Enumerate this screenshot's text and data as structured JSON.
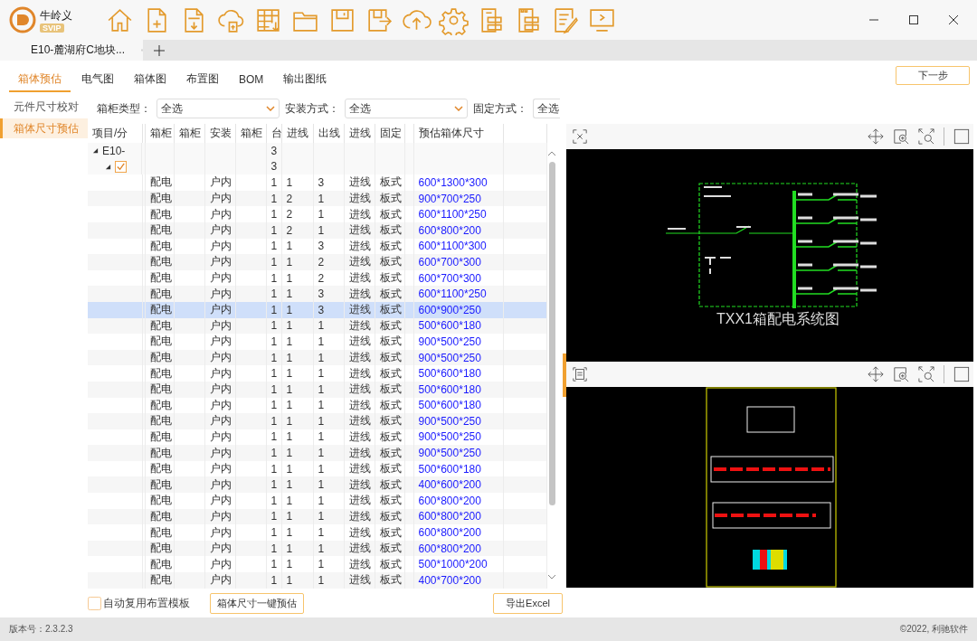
{
  "app": {
    "name": "牛岭义",
    "badge": "SVIP"
  },
  "document_tabs": [
    {
      "label": "E10-麓湖府C地块...",
      "selected": true
    }
  ],
  "nav_tabs": [
    {
      "label": "箱体预估",
      "selected": true
    },
    {
      "label": "电气图",
      "selected": false
    },
    {
      "label": "箱体图",
      "selected": false
    },
    {
      "label": "布置图",
      "selected": false
    },
    {
      "label": "BOM",
      "selected": false
    },
    {
      "label": "输出图纸",
      "selected": false
    }
  ],
  "next_button": "下一步",
  "sidebar": {
    "items": [
      {
        "label": "元件尺寸校对",
        "selected": false
      },
      {
        "label": "箱体尺寸预估",
        "selected": true
      }
    ]
  },
  "filters": [
    {
      "label": "箱柜类型：",
      "value": "全选",
      "caret": true
    },
    {
      "label": "安装方式：",
      "value": "全选",
      "caret": true
    },
    {
      "label": "固定方式：",
      "value": "全选",
      "caret": false
    }
  ],
  "table": {
    "columns": [
      "项目/分",
      "箱柜",
      "箱柜",
      "安装",
      "箱柜",
      "台",
      "进线",
      "出线",
      "进线",
      "固定",
      "",
      "预估箱体尺寸"
    ],
    "tree": [
      {
        "label": "E10-",
        "count": "3",
        "expanded": true,
        "kind": "project"
      },
      {
        "count": "3",
        "expanded": true,
        "checked": true,
        "kind": "group"
      }
    ],
    "rows": [
      {
        "cabinet": "配电",
        "install": "户内",
        "qty": "1",
        "in_lines": "1",
        "out_lines": "3",
        "in_mode": "进线",
        "fixing": "板式",
        "size": "600*1300*300",
        "selected": false
      },
      {
        "cabinet": "配电",
        "install": "户内",
        "qty": "1",
        "in_lines": "2",
        "out_lines": "1",
        "in_mode": "进线",
        "fixing": "板式",
        "size": "900*700*250",
        "selected": false
      },
      {
        "cabinet": "配电",
        "install": "户内",
        "qty": "1",
        "in_lines": "2",
        "out_lines": "1",
        "in_mode": "进线",
        "fixing": "板式",
        "size": "600*1100*250",
        "selected": false
      },
      {
        "cabinet": "配电",
        "install": "户内",
        "qty": "1",
        "in_lines": "2",
        "out_lines": "1",
        "in_mode": "进线",
        "fixing": "板式",
        "size": "600*800*200",
        "selected": false
      },
      {
        "cabinet": "配电",
        "install": "户内",
        "qty": "1",
        "in_lines": "1",
        "out_lines": "3",
        "in_mode": "进线",
        "fixing": "板式",
        "size": "600*1100*300",
        "selected": false
      },
      {
        "cabinet": "配电",
        "install": "户内",
        "qty": "1",
        "in_lines": "1",
        "out_lines": "2",
        "in_mode": "进线",
        "fixing": "板式",
        "size": "600*700*300",
        "selected": false
      },
      {
        "cabinet": "配电",
        "install": "户内",
        "qty": "1",
        "in_lines": "1",
        "out_lines": "2",
        "in_mode": "进线",
        "fixing": "板式",
        "size": "600*700*300",
        "selected": false
      },
      {
        "cabinet": "配电",
        "install": "户内",
        "qty": "1",
        "in_lines": "1",
        "out_lines": "3",
        "in_mode": "进线",
        "fixing": "板式",
        "size": "600*1100*250",
        "selected": false
      },
      {
        "cabinet": "配电",
        "install": "户内",
        "qty": "1",
        "in_lines": "1",
        "out_lines": "3",
        "in_mode": "进线",
        "fixing": "板式",
        "size": "600*900*250",
        "selected": true
      },
      {
        "cabinet": "配电",
        "install": "户内",
        "qty": "1",
        "in_lines": "1",
        "out_lines": "1",
        "in_mode": "进线",
        "fixing": "板式",
        "size": "500*600*180",
        "selected": false
      },
      {
        "cabinet": "配电",
        "install": "户内",
        "qty": "1",
        "in_lines": "1",
        "out_lines": "1",
        "in_mode": "进线",
        "fixing": "板式",
        "size": "900*500*250",
        "selected": false
      },
      {
        "cabinet": "配电",
        "install": "户内",
        "qty": "1",
        "in_lines": "1",
        "out_lines": "1",
        "in_mode": "进线",
        "fixing": "板式",
        "size": "900*500*250",
        "selected": false
      },
      {
        "cabinet": "配电",
        "install": "户内",
        "qty": "1",
        "in_lines": "1",
        "out_lines": "1",
        "in_mode": "进线",
        "fixing": "板式",
        "size": "500*600*180",
        "selected": false
      },
      {
        "cabinet": "配电",
        "install": "户内",
        "qty": "1",
        "in_lines": "1",
        "out_lines": "1",
        "in_mode": "进线",
        "fixing": "板式",
        "size": "500*600*180",
        "selected": false
      },
      {
        "cabinet": "配电",
        "install": "户内",
        "qty": "1",
        "in_lines": "1",
        "out_lines": "1",
        "in_mode": "进线",
        "fixing": "板式",
        "size": "500*600*180",
        "selected": false
      },
      {
        "cabinet": "配电",
        "install": "户内",
        "qty": "1",
        "in_lines": "1",
        "out_lines": "1",
        "in_mode": "进线",
        "fixing": "板式",
        "size": "900*500*250",
        "selected": false
      },
      {
        "cabinet": "配电",
        "install": "户内",
        "qty": "1",
        "in_lines": "1",
        "out_lines": "1",
        "in_mode": "进线",
        "fixing": "板式",
        "size": "900*500*250",
        "selected": false
      },
      {
        "cabinet": "配电",
        "install": "户内",
        "qty": "1",
        "in_lines": "1",
        "out_lines": "1",
        "in_mode": "进线",
        "fixing": "板式",
        "size": "900*500*250",
        "selected": false
      },
      {
        "cabinet": "配电",
        "install": "户内",
        "qty": "1",
        "in_lines": "1",
        "out_lines": "1",
        "in_mode": "进线",
        "fixing": "板式",
        "size": "500*600*180",
        "selected": false
      },
      {
        "cabinet": "配电",
        "install": "户内",
        "qty": "1",
        "in_lines": "1",
        "out_lines": "1",
        "in_mode": "进线",
        "fixing": "板式",
        "size": "400*600*200",
        "selected": false
      },
      {
        "cabinet": "配电",
        "install": "户内",
        "qty": "1",
        "in_lines": "1",
        "out_lines": "1",
        "in_mode": "进线",
        "fixing": "板式",
        "size": "600*800*200",
        "selected": false
      },
      {
        "cabinet": "配电",
        "install": "户内",
        "qty": "1",
        "in_lines": "1",
        "out_lines": "1",
        "in_mode": "进线",
        "fixing": "板式",
        "size": "600*800*200",
        "selected": false
      },
      {
        "cabinet": "配电",
        "install": "户内",
        "qty": "1",
        "in_lines": "1",
        "out_lines": "1",
        "in_mode": "进线",
        "fixing": "板式",
        "size": "600*800*200",
        "selected": false
      },
      {
        "cabinet": "配电",
        "install": "户内",
        "qty": "1",
        "in_lines": "1",
        "out_lines": "1",
        "in_mode": "进线",
        "fixing": "板式",
        "size": "600*800*200",
        "selected": false
      },
      {
        "cabinet": "配电",
        "install": "户内",
        "qty": "1",
        "in_lines": "1",
        "out_lines": "1",
        "in_mode": "进线",
        "fixing": "板式",
        "size": "500*1000*200",
        "selected": false
      },
      {
        "cabinet": "配电",
        "install": "户内",
        "qty": "1",
        "in_lines": "1",
        "out_lines": "1",
        "in_mode": "进线",
        "fixing": "板式",
        "size": "400*700*200",
        "selected": false
      }
    ]
  },
  "auto_reuse": {
    "label": "自动复用布置模板",
    "checked": false
  },
  "estimate_button": "箱体尺寸一键预估",
  "export_button": "导出Excel",
  "schematic": {
    "title": "TXX1箱配电系统图"
  },
  "status_bar": {
    "version": "版本号：2.3.2.3",
    "copyright": "©2022, 利驰软件"
  }
}
